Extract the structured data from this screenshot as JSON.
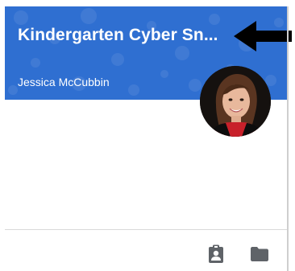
{
  "card": {
    "class_title": "Kindergarten Cyber Sn...",
    "teacher_name": "Jessica McCubbin",
    "banner_color": "#2f6fd1"
  },
  "annotation": {
    "icon": "arrow-left-icon",
    "color": "#000000"
  },
  "footer": {
    "icons": [
      "assignment-ind-icon",
      "folder-icon"
    ],
    "icon_color": "#5f6368"
  }
}
